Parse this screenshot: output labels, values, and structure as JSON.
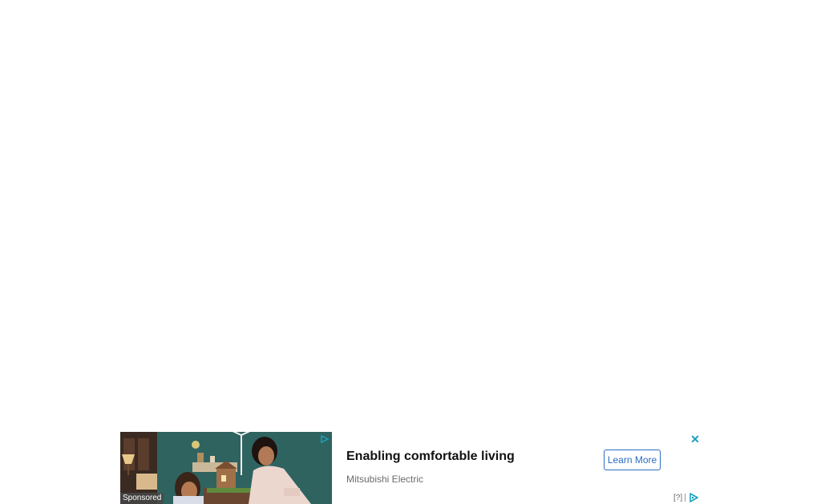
{
  "ad": {
    "sponsored_label": "Sponsored",
    "headline": "Enabling comfortable living",
    "advertiser": "Mitsubishi Electric",
    "cta_label": "Learn More",
    "close_symbol": "✕",
    "adchoices_help": "[?]",
    "icons": {
      "close": "close-icon",
      "adchoices": "adchoices-icon"
    },
    "colors": {
      "cta": "#2a6ec4",
      "close": "#18a0bf",
      "adchoices": "#18a0bf"
    }
  }
}
